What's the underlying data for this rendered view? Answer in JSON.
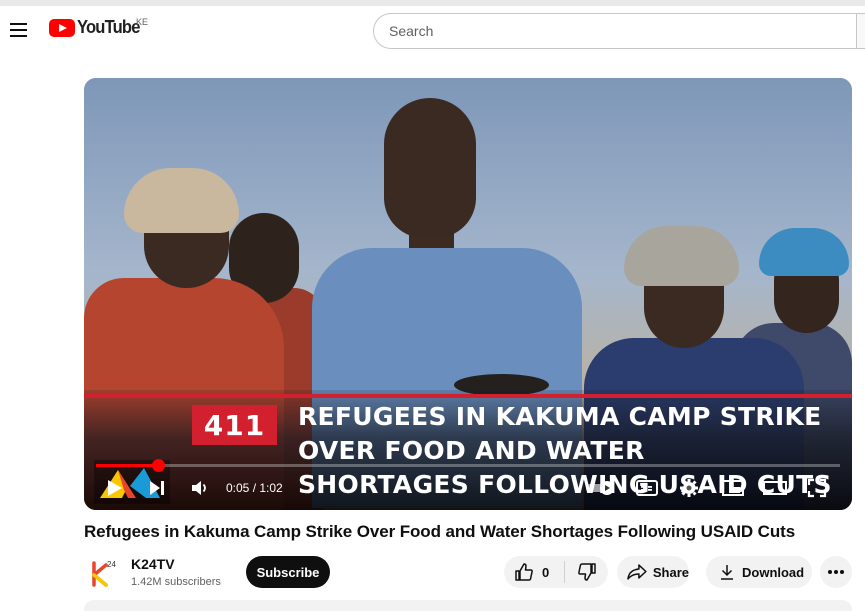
{
  "masthead": {
    "logo_text": "YouTube",
    "country_code": "KE",
    "search_placeholder": "Search",
    "menu_icon": "hamburger-menu-icon"
  },
  "player": {
    "overlay": {
      "number": "411",
      "headline_lines": [
        "REFUGEES IN KAKUMA CAMP STRIKE",
        "OVER FOOD AND WATER",
        "SHORTAGES FOLLOWING USAID CUTS"
      ]
    },
    "time_display": "0:05 / 1:02",
    "progress_fraction": 0.083,
    "controls": [
      "play-icon",
      "next-icon",
      "volume-icon",
      "autoplay-toggle-icon",
      "captions-icon",
      "settings-icon",
      "miniplayer-icon",
      "theater-icon",
      "fullscreen-icon"
    ]
  },
  "video": {
    "title": "Refugees in Kakuma Camp Strike Over Food and Water Shortages Following USAID Cuts"
  },
  "owner": {
    "channel_name": "K24TV",
    "subscribers": "1.42M subscribers",
    "subscribe_label": "Subscribe"
  },
  "actions": {
    "like_count": "0",
    "share_label": "Share",
    "download_label": "Download"
  },
  "colors": {
    "brand_red": "#ff0000",
    "overlay_red": "#d2202f",
    "subscribe_bg": "#0f0f0f",
    "pill_bg": "#f2f2f2"
  }
}
